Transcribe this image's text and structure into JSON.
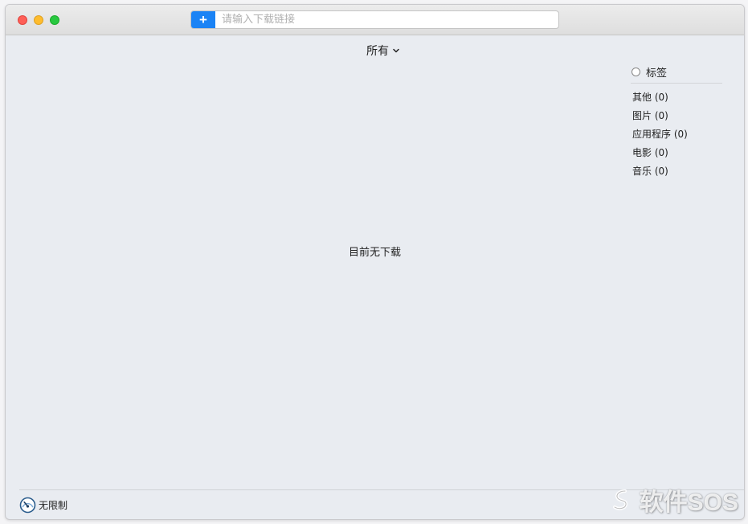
{
  "toolbar": {
    "add_symbol": "+",
    "url_placeholder": "请输入下载链接",
    "url_value": ""
  },
  "filter": {
    "selected": "所有"
  },
  "tags": {
    "header": "标签",
    "items": [
      {
        "label": "其他 (0)"
      },
      {
        "label": "图片 (0)"
      },
      {
        "label": "应用程序 (0)"
      },
      {
        "label": "电影 (0)"
      },
      {
        "label": "音乐 (0)"
      }
    ]
  },
  "main": {
    "empty_message": "目前无下载"
  },
  "status": {
    "speed_limit": "无限制"
  },
  "watermark": {
    "text": "软件SOS"
  },
  "colors": {
    "accent": "#1b83f5",
    "close": "#fe5f57",
    "minimize": "#febc2e",
    "maximize": "#28c840",
    "background": "#e9ecf1"
  },
  "icons": {
    "add": "plus-icon",
    "filter_toggle": "chevron-down-icon",
    "tag_toggle": "radio-icon",
    "speed": "speedometer-icon"
  }
}
